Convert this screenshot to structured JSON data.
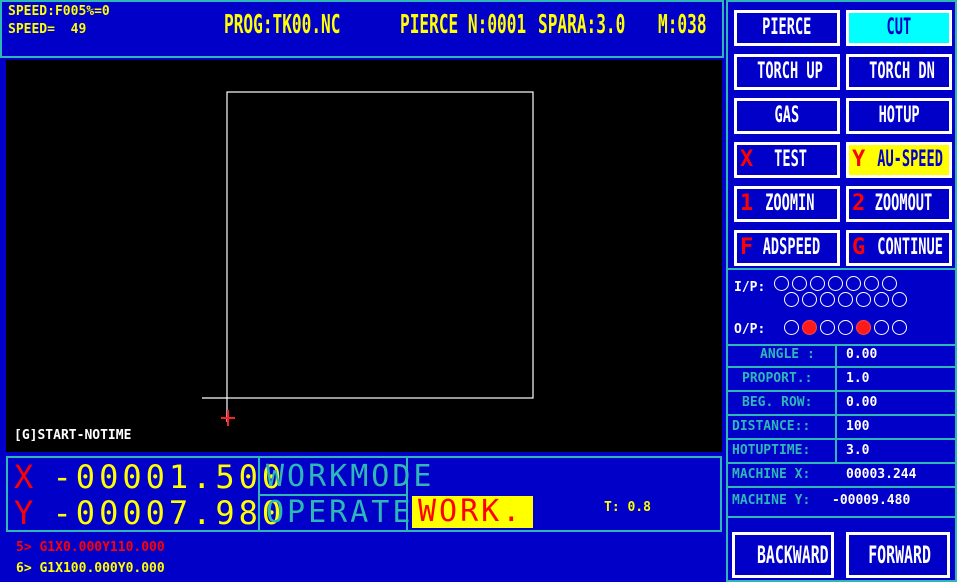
{
  "top": {
    "speed_f": "SPEED:F005%=0",
    "speed": "SPEED=  49",
    "prog": "PROG:TK00.NC",
    "pierce": "PIERCE N:0001",
    "spara": "SPARA:3.0",
    "m": "M:038"
  },
  "canvas": {
    "status": "[G]START-NOTIME"
  },
  "coords": {
    "x_label": "X",
    "x_value": "-00001.500",
    "y_label": "Y",
    "y_value": "-00007.980",
    "mode1": "WORKMODE",
    "mode2": "OPERATE",
    "work": "WORK.",
    "t": "T: 0.8"
  },
  "program": {
    "line5": "5> G1X0.000Y110.000",
    "line6": "6> G1X100.000Y0.000"
  },
  "softkeys": [
    {
      "label": "PIERCE",
      "key": ""
    },
    {
      "label": "CUT",
      "key": ""
    },
    {
      "label": "TORCH UP",
      "key": ""
    },
    {
      "label": "TORCH DN",
      "key": ""
    },
    {
      "label": "GAS",
      "key": ""
    },
    {
      "label": "HOTUP",
      "key": ""
    },
    {
      "label": "TEST",
      "key": "X"
    },
    {
      "label": "AU-SPEED",
      "key": "Y"
    },
    {
      "label": "ZOOMIN",
      "key": "1"
    },
    {
      "label": "ZOOMOUT",
      "key": "2"
    },
    {
      "label": "ADSPEED",
      "key": "F"
    },
    {
      "label": "CONTINUE",
      "key": "G"
    }
  ],
  "io": {
    "ip_label": "I/P:",
    "op_label": "O/P:",
    "op_on": [
      false,
      true,
      false,
      false,
      true,
      false,
      false
    ]
  },
  "params": [
    {
      "label": "ANGLE :",
      "value": "0.00"
    },
    {
      "label": "PROPORT.:",
      "value": "1.0"
    },
    {
      "label": "BEG. ROW:",
      "value": "0.00"
    },
    {
      "label": "DISTANCE::",
      "value": "100"
    },
    {
      "label": "HOTUPTIME:",
      "value": "3.0"
    },
    {
      "label": "MACHINE X:",
      "value": "00003.244"
    },
    {
      "label": "MACHINE Y:",
      "value": "-00009.480"
    }
  ],
  "bottom_buttons": {
    "backward": "BACKWARD",
    "forward": "FORWARD"
  },
  "colors": {
    "background": "#0000c8",
    "border": "#2fb7b7",
    "accent_yellow": "#ffff00",
    "alert_red": "#ff0000",
    "canvas": "#000000"
  }
}
